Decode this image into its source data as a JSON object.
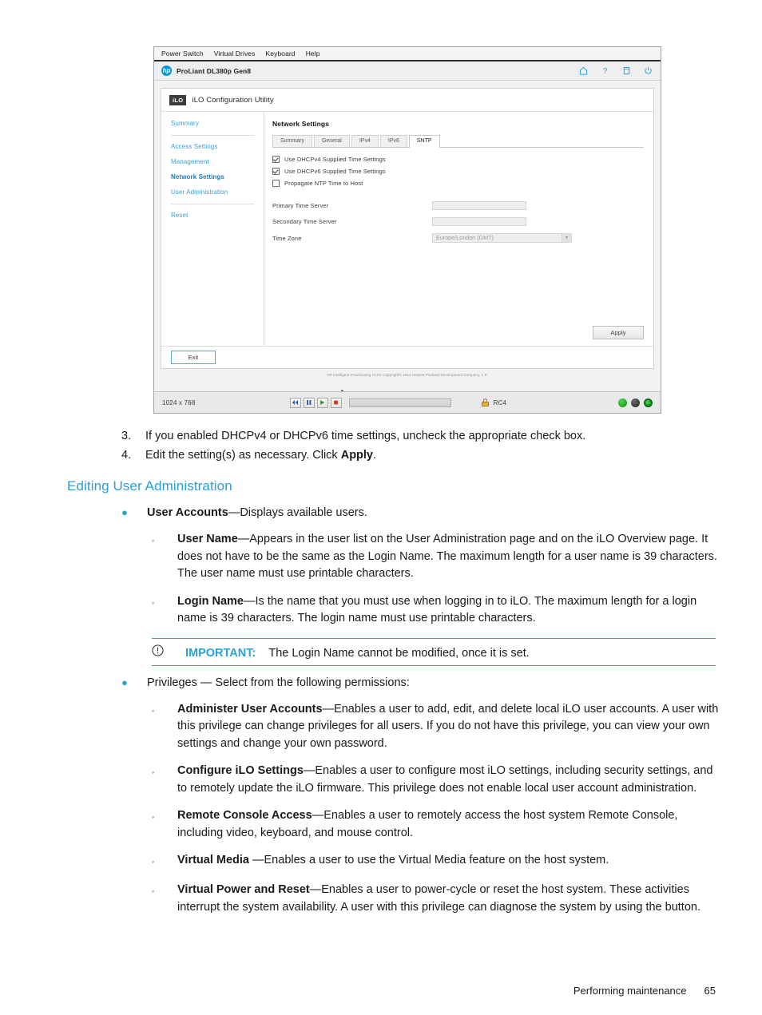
{
  "console": {
    "menu_items": [
      "Power Switch",
      "Virtual Drives",
      "Keyboard",
      "Help"
    ],
    "product_title": "ProLiant DL380p Gen8",
    "hp_logo_text": "hp",
    "header_icons": [
      "home-icon",
      "help-icon",
      "window-icon",
      "power-icon"
    ],
    "utility": {
      "badge": "iLO",
      "title": "iLO Configuration Utility"
    },
    "nav": {
      "items": [
        {
          "label": "Summary",
          "active": false
        },
        {
          "label": "Access Settings",
          "active": false
        },
        {
          "label": "Management",
          "active": false
        },
        {
          "label": "Network Settings",
          "active": true
        },
        {
          "label": "User Administration",
          "active": false
        },
        {
          "label": "Reset",
          "active": false
        }
      ]
    },
    "content": {
      "title": "Network Settings",
      "tabs": [
        {
          "label": "Summary",
          "active": false
        },
        {
          "label": "General",
          "active": false
        },
        {
          "label": "IPv4",
          "active": false
        },
        {
          "label": "IPv6",
          "active": false
        },
        {
          "label": "SNTP",
          "active": true
        }
      ],
      "checkboxes": [
        {
          "label": "Use DHCPv4 Supplied Time Settings",
          "checked": true
        },
        {
          "label": "Use DHCPv6 Supplied Time Settings",
          "checked": true
        },
        {
          "label": "Propagate NTP Time to Host",
          "checked": false
        }
      ],
      "fields": [
        {
          "label": "Primary Time Server",
          "value": ""
        },
        {
          "label": "Secondary Time Server",
          "value": ""
        }
      ],
      "timezone": {
        "label": "Time Zone",
        "value": "Europe/London (GMT)"
      },
      "apply_label": "Apply",
      "exit_label": "Exit",
      "copyright": "HP Intelligent Provisioning v1.6X Copyright© 2014 Hewlett Packard Development Company, L.P."
    },
    "statusbar": {
      "resolution": "1024 x 768",
      "media_buttons": [
        "rewind-icon",
        "pause-icon",
        "play-icon",
        "record-icon"
      ],
      "encryption": "RC4",
      "lock_icon": "lock-icon",
      "leds": [
        "green",
        "dark",
        "ring"
      ]
    }
  },
  "document": {
    "steps": [
      {
        "num": "3.",
        "text": "If you enabled DHCPv4 or DHCPv6 time settings, uncheck the appropriate check box."
      },
      {
        "num": "4.",
        "text_before": "Edit the setting(s) as necessary. Click ",
        "bold": "Apply",
        "text_after": "."
      }
    ],
    "section_heading": "Editing User Administration",
    "bullet1": {
      "bold": "User Accounts",
      "text": "—Displays available users."
    },
    "sub_user_name": {
      "bold": "User Name",
      "text": "—Appears in the user list on the User Administration page and on the iLO Overview page. It does not have to be the same as the Login Name. The maximum length for a user name is 39 characters. The user name must use printable characters."
    },
    "sub_login_name": {
      "bold": "Login Name",
      "text": "—Is the name that you must use when logging in to iLO. The maximum length for a login name is 39 characters. The login name must use printable characters."
    },
    "important": {
      "icon": "important-icon",
      "label": "IMPORTANT:",
      "text": "The Login Name cannot be modified, once it is set."
    },
    "bullet2": {
      "text": "Privileges — Select from the following permissions:"
    },
    "privileges": [
      {
        "bold": "Administer User Accounts",
        "text": "—Enables a user to add, edit, and delete local iLO user accounts. A user with this privilege can change privileges for all users. If you do not have this privilege, you can view your own settings and change your own password."
      },
      {
        "bold": "Configure iLO Settings",
        "text": "—Enables a user to configure most iLO settings, including security settings, and to remotely update the iLO firmware. This privilege does not enable local user account administration."
      },
      {
        "bold": "Remote Console Access",
        "text": "—Enables a user to remotely access the host system Remote Console, including video, keyboard, and mouse control."
      },
      {
        "bold": "Virtual Media ",
        "text": "—Enables a user to use the Virtual Media feature on the host system."
      },
      {
        "bold": "Virtual Power and Reset",
        "text": "—Enables a user to power-cycle or reset the host system. These activities interrupt the system availability. A user with this privilege can diagnose the system by using the button."
      }
    ],
    "footer": {
      "chapter": "Performing maintenance",
      "page": "65"
    }
  }
}
